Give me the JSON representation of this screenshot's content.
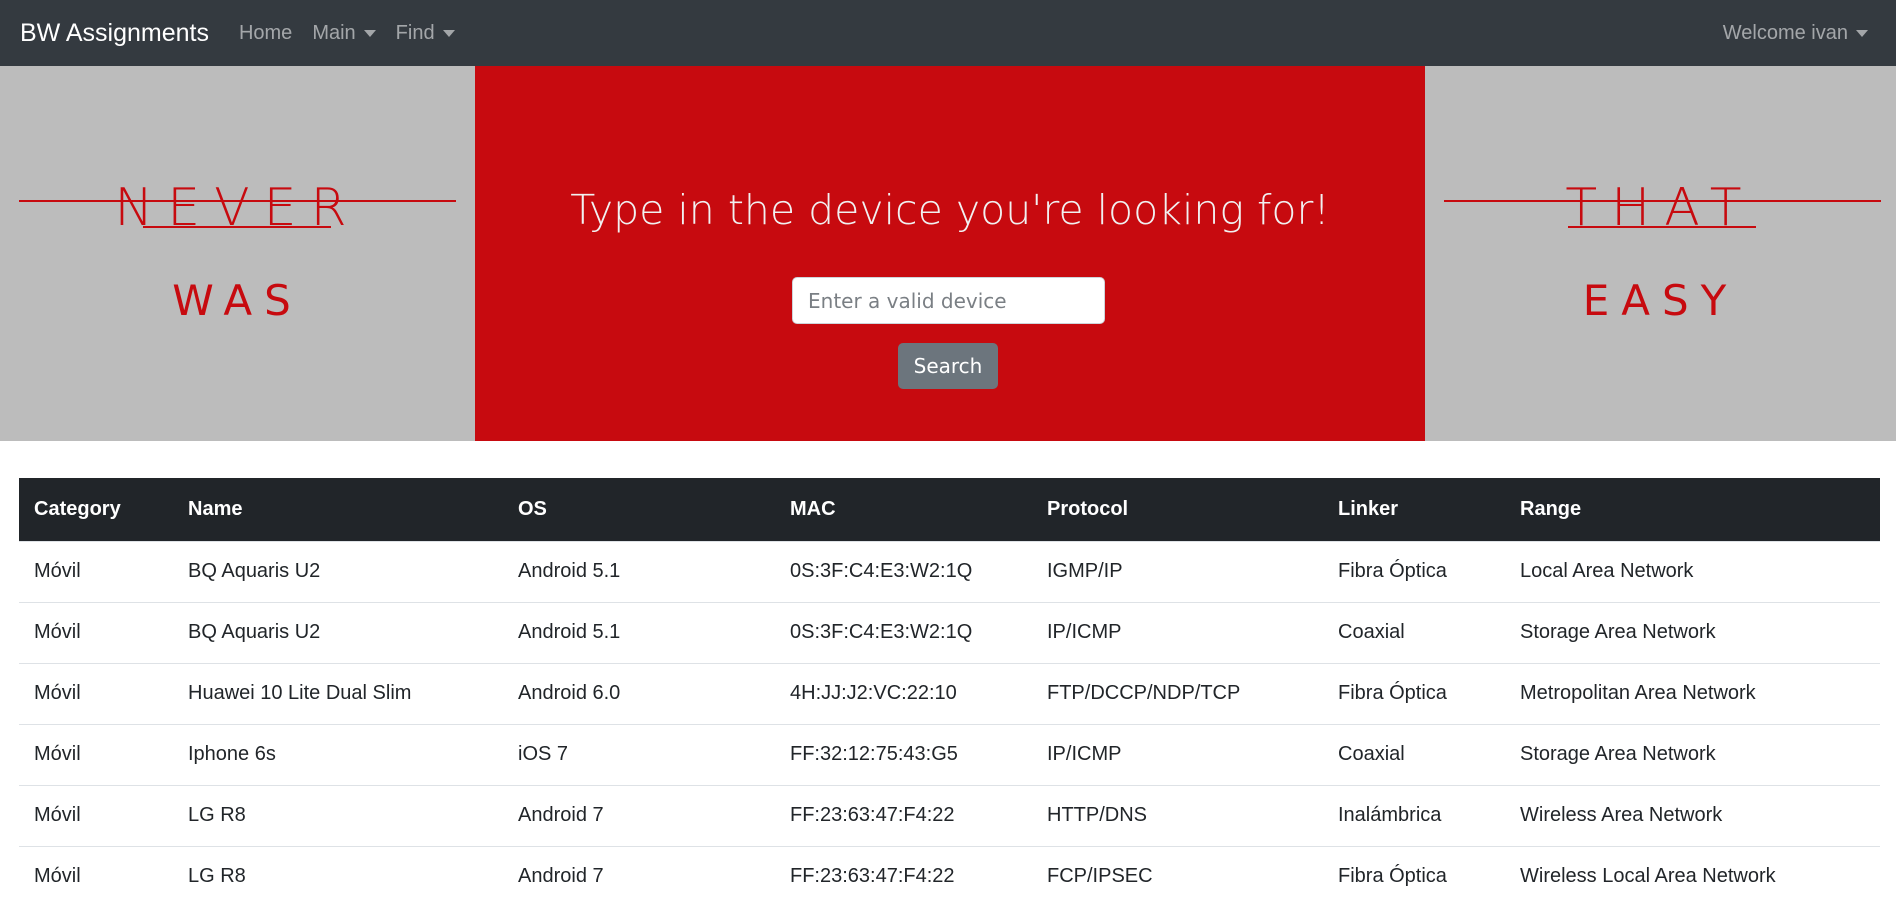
{
  "navbar": {
    "brand": "BW Assignments",
    "links": [
      {
        "label": "Home",
        "dropdown": false
      },
      {
        "label": "Main",
        "dropdown": true
      },
      {
        "label": "Find",
        "dropdown": true
      }
    ],
    "user_menu": "Welcome ivan"
  },
  "hero": {
    "left": {
      "top_word": "NEVER",
      "bottom_word": "WAS"
    },
    "right": {
      "top_word": "THAT",
      "bottom_word": "EASY"
    },
    "title": "Type in the device you're looking for!",
    "search_placeholder": "Enter a valid device",
    "search_value": "",
    "search_button": "Search"
  },
  "colors": {
    "navbar_bg": "#343a40",
    "accent_red": "#c70a0f",
    "side_gray": "#bcbcbc",
    "table_header_bg": "#212529",
    "button_gray": "#6c757d"
  },
  "table": {
    "headers": [
      "Category",
      "Name",
      "OS",
      "MAC",
      "Protocol",
      "Linker",
      "Range"
    ],
    "rows": [
      [
        "Móvil",
        "BQ Aquaris U2",
        "Android 5.1",
        "0S:3F:C4:E3:W2:1Q",
        "IGMP/IP",
        "Fibra Óptica",
        "Local Area Network"
      ],
      [
        "Móvil",
        "BQ Aquaris U2",
        "Android 5.1",
        "0S:3F:C4:E3:W2:1Q",
        "IP/ICMP",
        "Coaxial",
        "Storage Area Network"
      ],
      [
        "Móvil",
        "Huawei 10 Lite Dual Slim",
        "Android 6.0",
        "4H:JJ:J2:VC:22:10",
        "FTP/DCCP/NDP/TCP",
        "Fibra Óptica",
        "Metropolitan Area Network"
      ],
      [
        "Móvil",
        "Iphone 6s",
        "iOS 7",
        "FF:32:12:75:43:G5",
        "IP/ICMP",
        "Coaxial",
        "Storage Area Network"
      ],
      [
        "Móvil",
        "LG R8",
        "Android 7",
        "FF:23:63:47:F4:22",
        "HTTP/DNS",
        "Inalámbrica",
        "Wireless Area Network"
      ],
      [
        "Móvil",
        "LG R8",
        "Android 7",
        "FF:23:63:47:F4:22",
        "FCP/IPSEC",
        "Fibra Óptica",
        "Wireless Local Area Network"
      ]
    ]
  }
}
